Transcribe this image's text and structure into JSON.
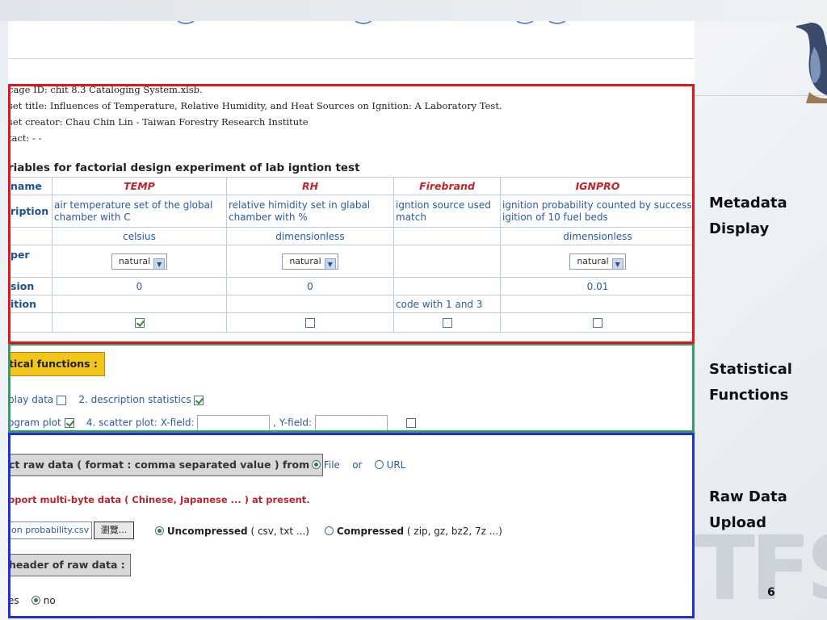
{
  "metadata": {
    "lines": [
      "cage ID: chit 8.3 Cataloging System.xlsb.",
      "set title: Influences of Temperature, Relative Humidity, and Heat Sources on Ignition: A Laboratory Test.",
      "set creator: Chau Chin Lin - Taiwan Forestry Research Institute",
      "tact: - -"
    ]
  },
  "variables": {
    "title": "riables for factorial design experiment of lab igntion test",
    "row_labels": [
      "name",
      "ription",
      "",
      "per",
      "sion",
      "ition",
      ""
    ],
    "columns": [
      {
        "name": "TEMP",
        "description": "air temperature set of the global chamber with C",
        "unit": "celsius",
        "type": "natural",
        "precision": "0",
        "definition": "",
        "checked": true
      },
      {
        "name": "RH",
        "description": "relative himidity set in glabal chamber with %",
        "unit": "dimensionless",
        "type": "natural",
        "precision": "0",
        "definition": "",
        "checked": false
      },
      {
        "name": "Firebrand",
        "description": "igntion source used match",
        "unit": "",
        "type": "",
        "precision": "",
        "definition": "code with 1 and 3",
        "checked": false
      },
      {
        "name": "IGNPRO",
        "description": "ignition probability counted by success igition of 10 fuel beds",
        "unit": "dimensionless",
        "type": "natural",
        "precision": "0.01",
        "definition": "",
        "checked": false
      }
    ]
  },
  "stats": {
    "button_label": "tical functions :",
    "opt1_label": "play data",
    "opt1_checked": false,
    "opt2_label": "2. description statistics",
    "opt2_checked": true,
    "opt3_label": "ogram plot",
    "opt3_checked": true,
    "opt4_label": "4. scatter plot: X-field:",
    "yfield_label": ", Y-field:",
    "opt5_checked": false
  },
  "upload": {
    "select_button": "ct raw data ( format : comma separated value ) from :",
    "file_label": "File",
    "or_label": "or",
    "url_label": "URL",
    "warning": "pport multi-byte data ( Chinese, Japanese ... ) at present.",
    "file_value": "ion probability.csv",
    "browse_label": "瀏覽...",
    "uncompressed_bold": "Uncompressed",
    "uncompressed_rest": " ( csv, txt ...)",
    "compressed_bold": "Compressed",
    "compressed_rest": " ( zip, gz, bz2, 7z ...)",
    "header_button": "header of raw data :",
    "yes_label": "es",
    "no_label": "no"
  },
  "labels": {
    "metadata_1": "Metadata",
    "metadata_2": "Display",
    "statistical_1": "Statistical",
    "statistical_2": "Functions",
    "raw_1": "Raw Data",
    "raw_2": "Upload"
  },
  "page_number": "6",
  "colors": {
    "metadata_frame": "#e3141b",
    "statistical_frame": "#3a9a6a",
    "upload_frame": "#1f2fe0",
    "header_red": "#c0242a",
    "link_blue": "#2a5aa0"
  }
}
